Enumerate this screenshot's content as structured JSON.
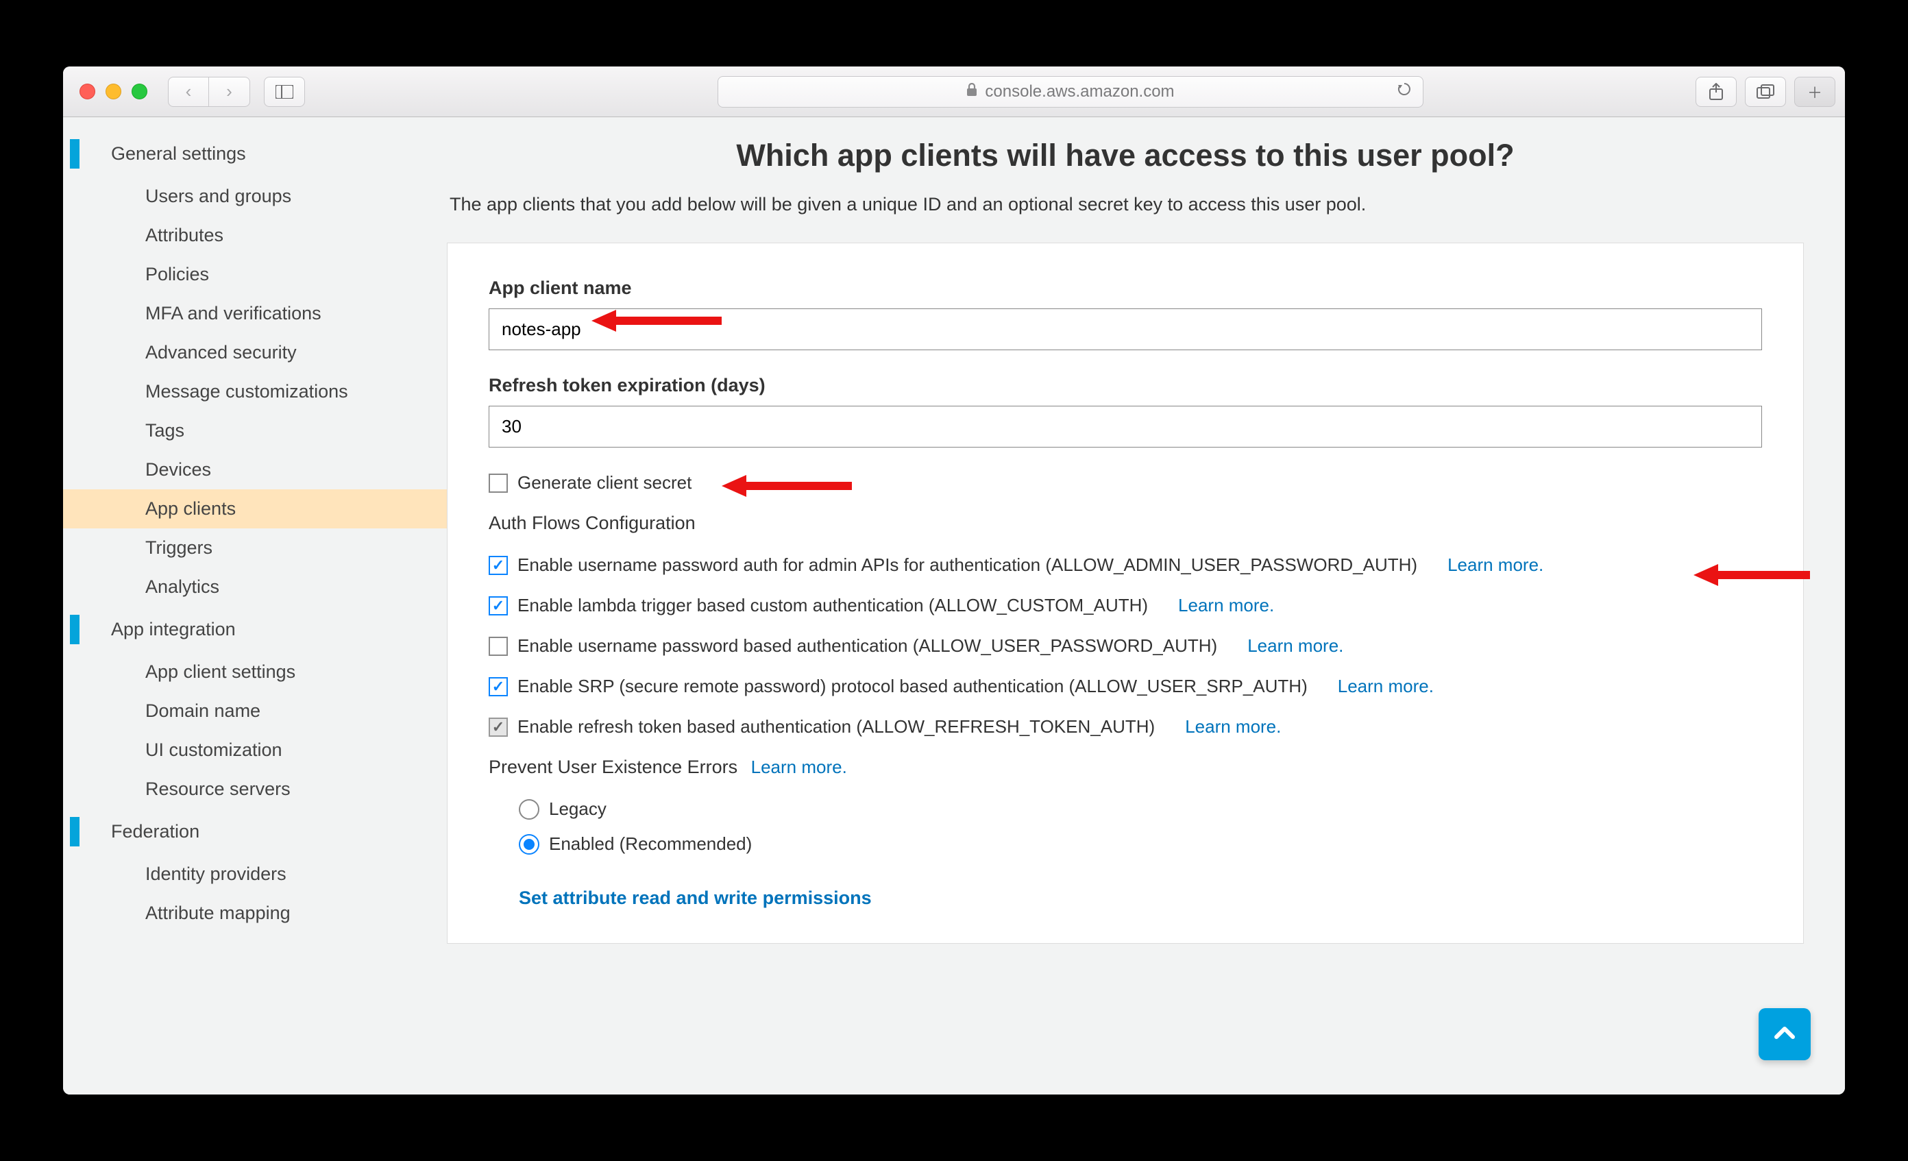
{
  "browser": {
    "url_display": "console.aws.amazon.com"
  },
  "sidenav": {
    "general": "General settings",
    "general_items": [
      "Users and groups",
      "Attributes",
      "Policies",
      "MFA and verifications",
      "Advanced security",
      "Message customizations",
      "Tags",
      "Devices",
      "App clients",
      "Triggers",
      "Analytics"
    ],
    "active_item": "App clients",
    "app_integration": "App integration",
    "app_integration_items": [
      "App client settings",
      "Domain name",
      "UI customization",
      "Resource servers"
    ],
    "federation": "Federation",
    "federation_items": [
      "Identity providers",
      "Attribute mapping"
    ]
  },
  "page": {
    "title": "Which app clients will have access to this user pool?",
    "subtitle": "The app clients that you add below will be given a unique ID and an optional secret key to access this user pool.",
    "app_client_name_label": "App client name",
    "app_client_name_value": "notes-app",
    "refresh_label": "Refresh token expiration (days)",
    "refresh_value": "30",
    "generate_secret": "Generate client secret",
    "auth_flows_heading": "Auth Flows Configuration",
    "flows": [
      {
        "checked": true,
        "disabled": false,
        "label": "Enable username password auth for admin APIs for authentication (ALLOW_ADMIN_USER_PASSWORD_AUTH)"
      },
      {
        "checked": true,
        "disabled": false,
        "label": "Enable lambda trigger based custom authentication (ALLOW_CUSTOM_AUTH)"
      },
      {
        "checked": false,
        "disabled": false,
        "label": "Enable username password based authentication (ALLOW_USER_PASSWORD_AUTH)"
      },
      {
        "checked": true,
        "disabled": false,
        "label": "Enable SRP (secure remote password) protocol based authentication (ALLOW_USER_SRP_AUTH)"
      },
      {
        "checked": true,
        "disabled": true,
        "label": "Enable refresh token based authentication (ALLOW_REFRESH_TOKEN_AUTH)"
      }
    ],
    "learn_more": "Learn more.",
    "prevent_errors_heading": "Prevent User Existence Errors",
    "radio_legacy": "Legacy",
    "radio_enabled": "Enabled (Recommended)",
    "attr_link": "Set attribute read and write permissions"
  }
}
